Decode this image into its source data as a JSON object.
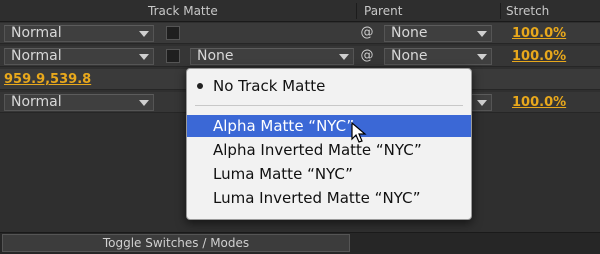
{
  "header": {
    "track_matte": "Track Matte",
    "parent": "Parent",
    "stretch": "Stretch"
  },
  "rows": [
    {
      "mode": "Normal",
      "parent": "None",
      "stretch": "100.0%"
    },
    {
      "mode": "Normal",
      "track_matte": "None",
      "parent": "None",
      "stretch": "100.0%"
    },
    {
      "position": "959.9,539.8"
    },
    {
      "mode": "Normal",
      "stretch": "100.0%"
    }
  ],
  "menu": {
    "items": [
      {
        "label": "No Track Matte",
        "checked": true
      },
      {
        "label": "Alpha Matte “NYC”",
        "selected": true
      },
      {
        "label": "Alpha Inverted Matte “NYC”"
      },
      {
        "label": "Luma Matte “NYC”"
      },
      {
        "label": "Luma Inverted Matte “NYC”"
      }
    ]
  },
  "bottom": {
    "toggle": "Toggle Switches / Modes"
  },
  "colors": {
    "accent_gold": "#e8a81c",
    "menu_highlight": "#3b68d6"
  }
}
